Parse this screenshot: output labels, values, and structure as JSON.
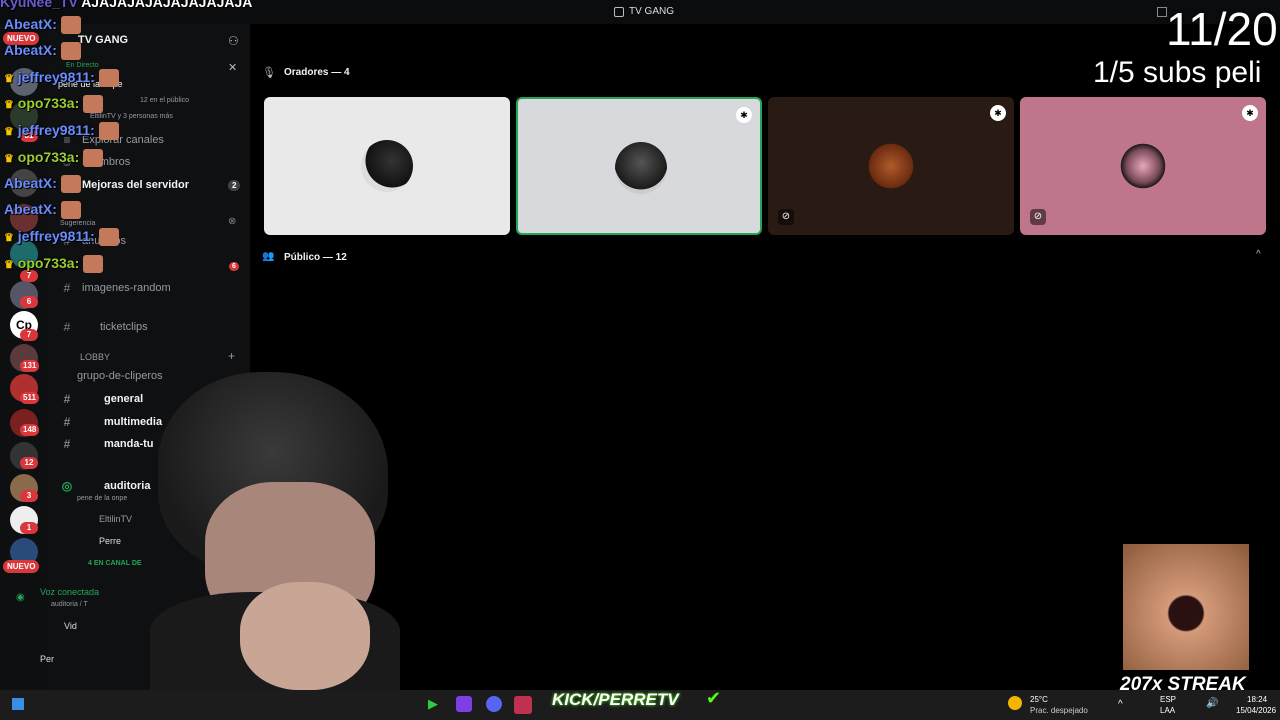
{
  "window": {
    "title": "TV GANG"
  },
  "server": {
    "name": "TV GANG",
    "live_label": "En Directo",
    "stage_topic": "pene de la onpe",
    "stage_audience": "12 en el público",
    "stage_sub": "EltilinTV y 3 personas más"
  },
  "sidebar": {
    "items": [
      {
        "label": "Explorar canales"
      },
      {
        "label": "Miembros"
      },
      {
        "label": "Mejoras del servidor",
        "badge": "2"
      },
      {
        "label": "Sugerencia"
      },
      {
        "label": "anuncios",
        "badge": "6"
      },
      {
        "label": "imagenes-random"
      },
      {
        "label": "ticketclips"
      }
    ],
    "category_lobby": "LOBBY",
    "lobby_channels": [
      {
        "label": "grupo-de-cliperos"
      },
      {
        "label": "general"
      },
      {
        "label": "multimedia"
      },
      {
        "label": "manda-tu"
      }
    ],
    "voice_channel": {
      "label": "auditoria",
      "topic": "pene de la onpe"
    },
    "voice_users": [
      "EltilinTV",
      "Perre"
    ],
    "in_channel_label": "4 EN CANAL DE",
    "voice_status": "Voz conectada",
    "voice_status_sub": "auditoria / T",
    "video_label": "Vid",
    "user_short": "Per"
  },
  "rail": {
    "nuevo_label": "NUEVO",
    "badges": [
      "31",
      "7",
      "6",
      "7",
      "131",
      "511",
      "148",
      "12",
      "3",
      "1"
    ]
  },
  "stage": {
    "speakers_label": "Oradores — 4",
    "audience_label": "Público — 12",
    "tiles": [
      {
        "bg": "#e9e9ea"
      },
      {
        "bg": "#d8d9dc"
      },
      {
        "bg": "#2a1a14"
      },
      {
        "bg": "#c0768a"
      }
    ]
  },
  "chat": [
    {
      "user": "KyuNee_TV",
      "msg": "AJAJAJAJAJAJAJAJAJA",
      "color": "#6a5acd"
    },
    {
      "user": "AbeatX:",
      "msg": "",
      "color": "#6a8cff"
    },
    {
      "user": "AbeatX:",
      "msg": "",
      "color": "#6a8cff"
    },
    {
      "user": "jeffrey9811:",
      "msg": "",
      "color": "#6a8cff"
    },
    {
      "user": "opo733a:",
      "msg": "",
      "color": "#9acd32"
    },
    {
      "user": "jeffrey9811:",
      "msg": "",
      "color": "#6a8cff"
    },
    {
      "user": "opo733a:",
      "msg": "",
      "color": "#9acd32"
    },
    {
      "user": "AbeatX:",
      "msg": "",
      "color": "#6a8cff"
    },
    {
      "user": "AbeatX:",
      "msg": "",
      "color": "#6a8cff"
    },
    {
      "user": "jeffrey9811:",
      "msg": "",
      "color": "#6a8cff"
    },
    {
      "user": "opo733a:",
      "msg": "",
      "color": "#9acd32"
    }
  ],
  "overlay": {
    "counter": "11/20",
    "subs_goal": "1/5 subs peli",
    "streak": "207x STREAK",
    "kick_brand": "KICK/PERRETV"
  },
  "taskbar": {
    "weather_temp": "25°C",
    "weather_desc": "Prac. despejado",
    "lang": "ESP",
    "kbd": "LAA",
    "time": "18:24",
    "date": "15/04/2026"
  }
}
